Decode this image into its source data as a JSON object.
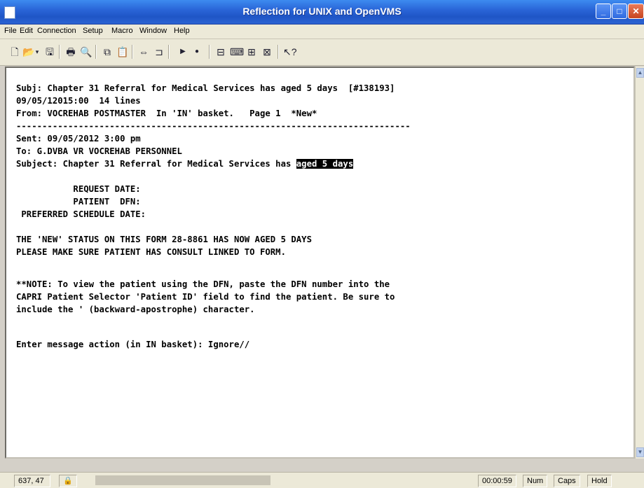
{
  "window": {
    "title": "Reflection for UNIX and OpenVMS"
  },
  "menu": [
    "File",
    "Edit",
    "Connection",
    "Setup",
    "Macro",
    "Window",
    "Help"
  ],
  "toolbar": {
    "icons": [
      "new-icon",
      "open-icon",
      "dropdown-arrow-icon",
      "save-icon",
      "print-icon",
      "find-icon",
      "copy-icon",
      "paste-icon",
      "connect-icon",
      "disconnect-icon",
      "play-icon",
      "record-icon",
      "setup-icon-1",
      "setup-icon-2",
      "setup-icon-3",
      "setup-icon-4",
      "help-pointer-icon"
    ]
  },
  "terminal": {
    "lines": [
      "Subj: Chapter 31 Referral for Medical Services has aged 5 days  [#138193]",
      "09/05/12015:00  14 lines",
      "From: VOCREHAB POSTMASTER  In 'IN' basket.   Page 1  *New*",
      "----------------------------------------------------------------------------",
      "Sent: 09/05/2012 3:00 pm",
      "To: G.DVBA VR VOCREHAB PERSONNEL",
      "Subject: Chapter 31 Referral for Medical Services has ",
      "",
      "           REQUEST DATE:",
      "           PATIENT  DFN:",
      " PREFERRED SCHEDULE DATE:",
      "",
      "THE 'NEW' STATUS ON THIS FORM 28-8861 HAS NOW AGED 5 DAYS",
      "PLEASE MAKE SURE PATIENT HAS CONSULT LINKED TO FORM.",
      "",
      "**NOTE: To view the patient using the DFN, paste the DFN number into the",
      "CAPRI Patient Selector 'Patient ID' field to find the patient. Be sure to",
      "include the ' (backward-apostrophe) character.",
      "",
      "Enter message action (in IN basket): Ignore//"
    ],
    "highlight": "aged 5 days"
  },
  "status": {
    "cursor": "637, 47",
    "time": "00:00:59",
    "num": "Num",
    "caps": "Caps",
    "hold": "Hold"
  }
}
